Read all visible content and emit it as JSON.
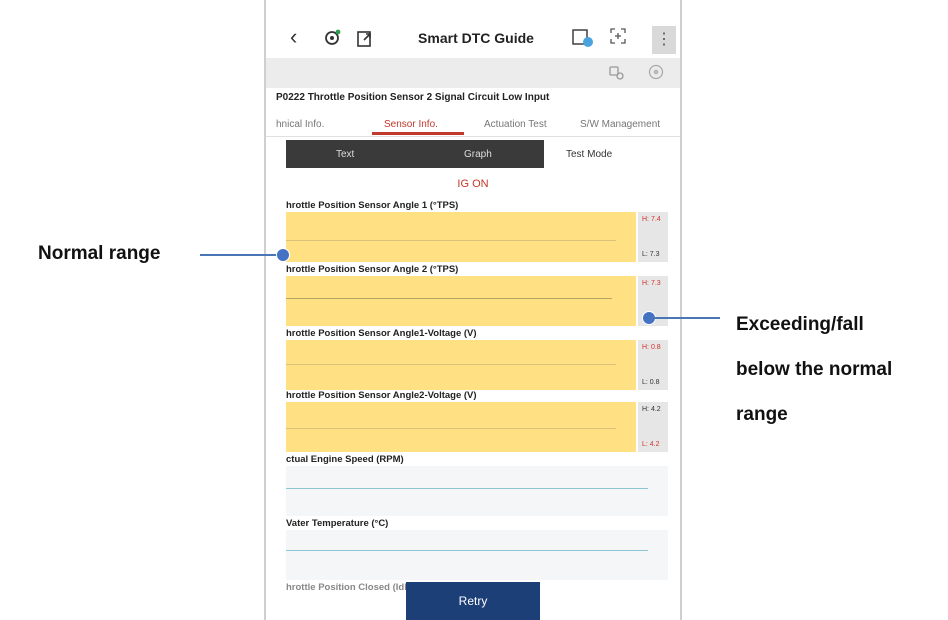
{
  "header": {
    "back_glyph": "‹",
    "title": "Smart DTC Guide",
    "more_glyph": "⋮"
  },
  "dtc": {
    "title": "P0222 Throttle Position Sensor 2 Signal Circuit Low Input"
  },
  "tabs": [
    {
      "label": "hnical Info."
    },
    {
      "label": "Sensor Info.",
      "active": true
    },
    {
      "label": "Actuation Test"
    },
    {
      "label": "S/W Management"
    }
  ],
  "segments": [
    {
      "label": "Text"
    },
    {
      "label": "Graph"
    },
    {
      "label": "Test Mode"
    }
  ],
  "status": "IG ON",
  "sensors": [
    {
      "label": "hrottle Position Sensor Angle 1 (°TPS)",
      "high": "H: 7.4",
      "low": "L: 7.3"
    },
    {
      "label": "hrottle Position Sensor Angle 2 (°TPS)",
      "high": "H: 7.3",
      "low": ""
    },
    {
      "label": "hrottle Position Sensor Angle1-Voltage (V)",
      "high": "H: 0.8",
      "low": "L: 0.8"
    },
    {
      "label": "hrottle Position Sensor Angle2-Voltage (V)",
      "high": "H: 4.2",
      "low": "L: 4.2"
    },
    {
      "label": "ctual Engine Speed (RPM)"
    },
    {
      "label": "Vater Temperature (°C)"
    },
    {
      "label": "hrottle Position Closed (Idle) (-)"
    }
  ],
  "retry_label": "Retry",
  "annotations": {
    "normal": "Normal range",
    "exceed_1": "Exceeding/fall",
    "exceed_2": "below the normal",
    "exceed_3": "range"
  },
  "colors": {
    "normal_band": "#ffe082",
    "accent": "#c0392b",
    "retry_bg": "#1c3f78",
    "marker": "#4472c4"
  }
}
